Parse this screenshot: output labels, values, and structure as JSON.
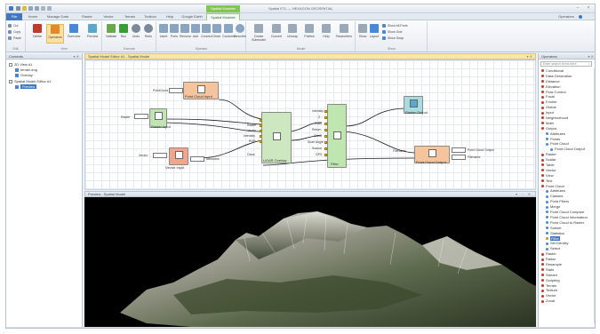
{
  "window": {
    "title": "Spatial ETL — HEXAGON GEOSPATIAL",
    "context_tab": "Spatial Modeler"
  },
  "ribbon_tabs": [
    {
      "label": "File",
      "kind": "file"
    },
    {
      "label": "Home",
      "kind": "normal"
    },
    {
      "label": "Manage Data",
      "kind": "normal"
    },
    {
      "label": "Raster",
      "kind": "normal"
    },
    {
      "label": "Vector",
      "kind": "normal"
    },
    {
      "label": "Terrain",
      "kind": "normal"
    },
    {
      "label": "Toolbox",
      "kind": "normal"
    },
    {
      "label": "Help",
      "kind": "normal"
    },
    {
      "label": "Google Earth",
      "kind": "normal"
    },
    {
      "label": "Spatial Modeler",
      "kind": "active"
    }
  ],
  "ribbon_right": {
    "label": "Operators",
    "help_icon": "help-icon"
  },
  "ribbon": {
    "groups": {
      "edit": "Edit",
      "view": "View",
      "execute": "Execute",
      "operator": "Operator",
      "model": "Model",
      "show": "Show"
    },
    "edit_rows": [
      "Cut",
      "Copy",
      "Paste"
    ],
    "view_buttons": [
      {
        "label": "Delete",
        "icon": "delete-icon",
        "color": "#c0392b"
      },
      {
        "label": "Operators",
        "icon": "operators-icon",
        "color": "#e08a2a",
        "selected": true
      },
      {
        "label": "Overview",
        "icon": "overview-icon",
        "color": "#4b87d6"
      },
      {
        "label": "Preview",
        "icon": "preview-icon",
        "color": "#5aa9c8"
      }
    ],
    "execute_buttons": [
      {
        "label": "Validate",
        "icon": "validate-icon",
        "color": "#6aa84f"
      },
      {
        "label": "Run",
        "icon": "run-icon",
        "color": "#3a9b3a"
      },
      {
        "label": "Undo",
        "icon": "undo-icon",
        "color": "#7a8a9a"
      },
      {
        "label": "Redo",
        "icon": "redo-icon",
        "color": "#7a8a9a"
      }
    ],
    "operator_buttons": [
      {
        "label": "Insert",
        "icon": "insert-icon",
        "color": "#8aa4c2"
      },
      {
        "label": "Ports",
        "icon": "ports-icon",
        "color": "#8aa4c2"
      },
      {
        "label": "Remove",
        "icon": "remove-icon",
        "color": "#8aa4c2"
      },
      {
        "label": "Add",
        "icon": "add-icon",
        "color": "#8aa4c2"
      },
      {
        "label": "Connect",
        "icon": "connect-icon",
        "color": "#8aa4c2"
      },
      {
        "label": "Order",
        "icon": "order-icon",
        "color": "#8aa4c2"
      },
      {
        "label": "Comment",
        "icon": "comment-icon",
        "color": "#8aa4c2"
      },
      {
        "label": "Describe",
        "icon": "describe-icon",
        "color": "#8aa4c2"
      }
    ],
    "model_buttons": [
      {
        "label": "Create Submodel",
        "icon": "submodel-icon",
        "color": "#9aa8b8"
      },
      {
        "label": "Convert",
        "icon": "convert-icon",
        "color": "#9aa8b8"
      },
      {
        "label": "Unwrap",
        "icon": "unwrap-icon",
        "color": "#9aa8b8"
      },
      {
        "label": "Publish",
        "icon": "publish-icon",
        "color": "#9aa8b8"
      },
      {
        "label": "Help",
        "icon": "model-help-icon",
        "color": "#9aa8b8"
      },
      {
        "label": "Parameters",
        "icon": "parameters-icon",
        "color": "#9aa8b8"
      }
    ],
    "show_buttons": [
      {
        "label": "Show",
        "icon": "show-icon",
        "color": "#9aa8b8"
      },
      {
        "label": "Layout",
        "icon": "layout-icon",
        "color": "#4b87d6"
      }
    ],
    "show_rows": [
      "Show All Ports",
      "Show Grid",
      "Show Snap"
    ]
  },
  "left_panel": {
    "title": "Contents",
    "items": [
      {
        "label": "2D View #1",
        "kind": "box",
        "indent": 0
      },
      {
        "label": "terrain.img",
        "kind": "cube",
        "indent": 1
      },
      {
        "label": "Overlay",
        "kind": "cube",
        "indent": 1
      },
      {
        "label": "Spatial Model Editor #1",
        "kind": "box",
        "indent": 0
      },
      {
        "label": "Preview",
        "kind": "cube",
        "indent": 1,
        "selected": true
      }
    ]
  },
  "editor": {
    "tab": "Spatial Model Editor #1 - Spatial Model"
  },
  "model": {
    "node_labels": {
      "point_cloud_input": "Point Cloud Input",
      "raster_input": "Raster Input",
      "vector_input": "Vector Input",
      "lidar_overlay": "LiDAR Overlay",
      "filter": "Filter",
      "raster_output": "Raster Output",
      "point_cloud_output": "Point Cloud Output"
    },
    "input_port_labels": {
      "raster": "Raster",
      "point_cloud": "PointCloud",
      "vector": "Vector",
      "file_name": "Filename",
      "attribute": "Attributes",
      "output_file": "Outfile"
    },
    "overlay_ports": [
      "Raster",
      "Vector",
      "Intensity",
      "RGB",
      "Class"
    ],
    "filter_ports": [
      "Intensity",
      "Z",
      "RGB",
      "Return",
      "Class",
      "Scan Angle",
      "Source",
      "GPS"
    ],
    "output_port_labels": [
      "Point Cloud Output",
      "Filename"
    ]
  },
  "view3d": {
    "title": "Preview - Spatial Model"
  },
  "right_panel": {
    "title": "Operators",
    "search_placeholder": "Enter search terms here",
    "items": [
      {
        "label": "Conditional",
        "bullet": "red"
      },
      {
        "label": "Data Generation",
        "bullet": "red"
      },
      {
        "label": "Distance",
        "bullet": "red"
      },
      {
        "label": "Elevation",
        "bullet": "red"
      },
      {
        "label": "Flow Control",
        "bullet": "red"
      },
      {
        "label": "Focal",
        "bullet": "red"
      },
      {
        "label": "Fourier",
        "bullet": "red"
      },
      {
        "label": "Global",
        "bullet": "red"
      },
      {
        "label": "Input",
        "bullet": "red"
      },
      {
        "label": "Neighborhood",
        "bullet": "red"
      },
      {
        "label": "Math",
        "bullet": "red"
      },
      {
        "label": "Output",
        "bullet": "red"
      },
      {
        "label": "Attributes",
        "bullet": "blue",
        "indent": 1
      },
      {
        "label": "Points",
        "bullet": "blue",
        "indent": 1
      },
      {
        "label": "Point Cloud",
        "bullet": "blue",
        "indent": 1
      },
      {
        "label": "Point Cloud Output",
        "bullet": "blue",
        "indent": 2
      },
      {
        "label": "Raster",
        "bullet": "red"
      },
      {
        "label": "Scalar",
        "bullet": "red"
      },
      {
        "label": "Table",
        "bullet": "red"
      },
      {
        "label": "Vector",
        "bullet": "red"
      },
      {
        "label": "View",
        "bullet": "red"
      },
      {
        "label": "Text",
        "bullet": "red"
      },
      {
        "label": "Point Cloud",
        "bullet": "red"
      },
      {
        "label": "Attributes",
        "bullet": "blue",
        "indent": 1
      },
      {
        "label": "Classes",
        "bullet": "blue",
        "indent": 1
      },
      {
        "label": "Point Filters",
        "bullet": "blue",
        "indent": 1
      },
      {
        "label": "Merge",
        "bullet": "blue",
        "indent": 1
      },
      {
        "label": "Point Cloud Compare",
        "bullet": "blue",
        "indent": 1
      },
      {
        "label": "Point Cloud Information",
        "bullet": "blue",
        "indent": 1
      },
      {
        "label": "Point Cloud to Raster",
        "bullet": "blue",
        "indent": 1
      },
      {
        "label": "Subset",
        "bullet": "blue",
        "indent": 1
      },
      {
        "label": "Statistics",
        "bullet": "blue",
        "indent": 1
      },
      {
        "label": "Filter",
        "bullet": "orange",
        "indent": 1,
        "selected": true
      },
      {
        "label": "Set Density",
        "bullet": "blue",
        "indent": 1
      },
      {
        "label": "Select",
        "bullet": "blue",
        "indent": 1
      },
      {
        "label": "Raster",
        "bullet": "red"
      },
      {
        "label": "Radar",
        "bullet": "red"
      },
      {
        "label": "Resample",
        "bullet": "red"
      },
      {
        "label": "Stats",
        "bullet": "red"
      },
      {
        "label": "Stream",
        "bullet": "red"
      },
      {
        "label": "Scripting",
        "bullet": "red"
      },
      {
        "label": "Terrain",
        "bullet": "red"
      },
      {
        "label": "Texture",
        "bullet": "red"
      },
      {
        "label": "Vector",
        "bullet": "red"
      },
      {
        "label": "Zonal",
        "bullet": "red"
      }
    ]
  }
}
